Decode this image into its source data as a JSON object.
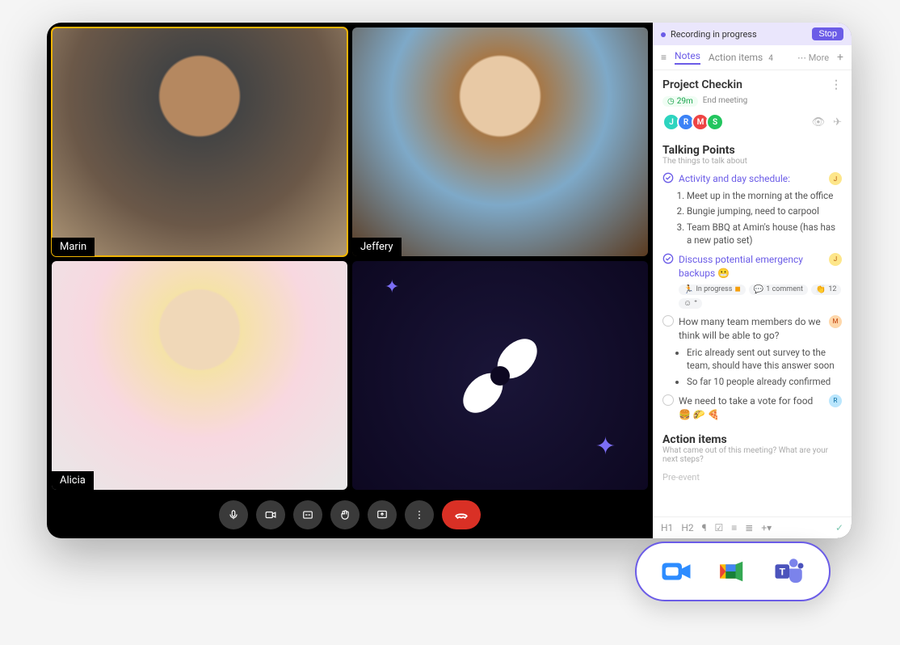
{
  "participants": [
    {
      "name": "Marin",
      "active": true
    },
    {
      "name": "Jeffery",
      "active": false
    },
    {
      "name": "Alicia",
      "active": false
    }
  ],
  "controls": {
    "mic": "mic-icon",
    "video": "video-icon",
    "cc": "cc-icon",
    "hand": "hand-icon",
    "share": "share-icon",
    "more": "more-icon",
    "hangup": "hangup-icon"
  },
  "sidebar": {
    "recording": {
      "status_text": "Recording in progress",
      "stop_label": "Stop"
    },
    "tabs": {
      "notes": "Notes",
      "action_items": "Action items",
      "action_count": "4",
      "more": "More"
    },
    "meeting": {
      "title": "Project Checkin",
      "duration": "29m",
      "end_label": "End meeting",
      "avatars": [
        {
          "letter": "J",
          "color": "#2dd4bf"
        },
        {
          "letter": "R",
          "color": "#3b82f6"
        },
        {
          "letter": "M",
          "color": "#ef4444"
        },
        {
          "letter": "S",
          "color": "#22c55e"
        }
      ]
    },
    "sections": {
      "talking_points": {
        "title": "Talking Points",
        "subtitle": "The things to talk about",
        "items": [
          {
            "done": true,
            "text": "Activity and day schedule:",
            "assignee": "j",
            "ordered_sub": [
              "Meet up in the morning at the office",
              "Bungie jumping, need to carpool",
              "Team BBQ at Amin's house (has has a new patio set)"
            ]
          },
          {
            "done": true,
            "text": "Discuss potential emergency backups 😬",
            "assignee": "j",
            "chips": [
              {
                "emoji": "🏃",
                "label": "In progress",
                "trail": "◼"
              },
              {
                "emoji": "💬",
                "label": "1 comment"
              },
              {
                "emoji": "👏",
                "label": "12"
              },
              {
                "emoji": "☺",
                "label": ""
              }
            ]
          },
          {
            "done": false,
            "text": "How many team members do we think will be able to go?",
            "assignee": "m",
            "bullet_sub": [
              "Eric already sent out survey to the team, should have this answer soon",
              "So far 10 people already confirmed"
            ]
          },
          {
            "done": false,
            "text": "We need to take a vote for food 🍔 🌮 🍕",
            "assignee": "r"
          }
        ]
      },
      "action_items": {
        "title": "Action items",
        "subtitle": "What came out of this meeting? What are your next steps?"
      },
      "faded": "Pre-event"
    },
    "toolbar": {
      "h1": "H1",
      "h2": "H2",
      "plus": "+"
    }
  },
  "integrations": [
    "zoom",
    "google-meet",
    "ms-teams"
  ]
}
